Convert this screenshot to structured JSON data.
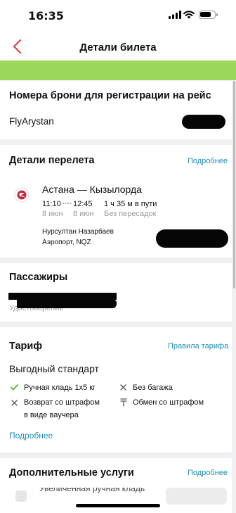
{
  "status": {
    "time": "16:35"
  },
  "nav": {
    "title": "Детали билета"
  },
  "booking": {
    "heading": "Номера брони для регистрации на рейс",
    "airline": "FlyArystan"
  },
  "flight": {
    "heading": "Детали перелета",
    "more": "Подробнее",
    "route": "Астана — Кызылорда",
    "depart_time": "11:10",
    "arrive_time": "12:45",
    "depart_date": "8 июн",
    "arrive_date": "8 июн",
    "duration": "1 ч 35 м в пути",
    "stops": "Без пересадок",
    "airport_line1": "Нурсултан Назарбаев",
    "airport_line2": "Аэропорт, NQZ"
  },
  "passengers": {
    "heading": "Пассажиры",
    "doc_label": "Удостоверение"
  },
  "tariff": {
    "heading": "Тариф",
    "rules": "Правила тарифа",
    "name": "Выгодный стандарт",
    "features": {
      "hand_baggage": "Ручная кладь 1х5 кг",
      "no_baggage": "Без багажа",
      "refund_line1": "Возврат со штрафом",
      "refund_line2": "в виде ваучера",
      "exchange": "Обмен со штрафом"
    },
    "more": "Подробнее"
  },
  "services": {
    "heading": "Дополнительные услуги",
    "more": "Подробнее",
    "partial_item": "Увеличенная ручная кладь"
  }
}
